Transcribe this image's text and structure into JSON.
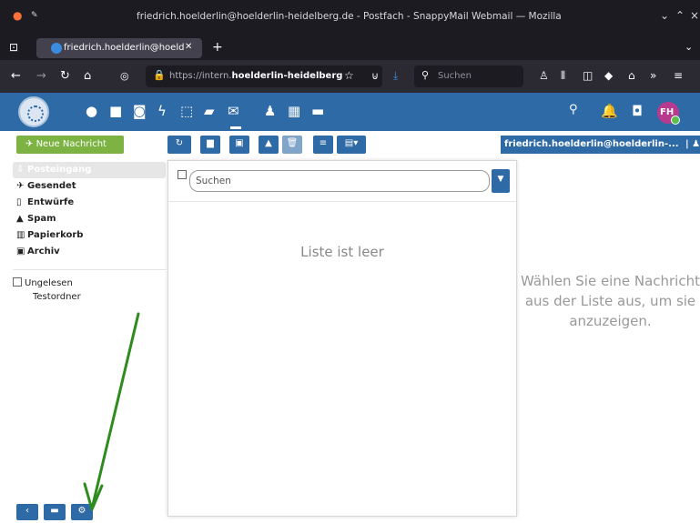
{
  "browser": {
    "window_title": "friedrich.hoelderlin@hoelderlin-heidelberg.de - Postfach - SnappyMail Webmail — Mozilla Firefox",
    "tab_title": "friedrich.hoelderlin@hoeld",
    "url_prefix": "https://intern.",
    "url_domain": "hoelderlin-heidelberg",
    "search_placeholder": "Suchen"
  },
  "app": {
    "avatar_initials": "FH",
    "compose_label": "Neue Nachricht",
    "account_label": "friedrich.hoelderlin@hoelderlin-...",
    "folders": [
      {
        "label": "Posteingang",
        "icon": "inbox-icon",
        "active": true
      },
      {
        "label": "Gesendet",
        "icon": "send-icon"
      },
      {
        "label": "Entwürfe",
        "icon": "draft-icon"
      },
      {
        "label": "Spam",
        "icon": "spam-icon"
      },
      {
        "label": "Papierkorb",
        "icon": "trash-icon"
      },
      {
        "label": "Archiv",
        "icon": "archive-icon"
      }
    ],
    "unread_label": "Ungelesen",
    "testfolder_label": "Testordner",
    "search_placeholder": "Suchen",
    "empty_list_text": "Liste ist leer",
    "preview_text": "Wählen Sie eine Nachricht aus der Liste aus, um sie anzuzeigen."
  },
  "colors": {
    "app_blue": "#2e6aa6",
    "compose_green": "#7cb342",
    "annotation_arrow": "#2e8b1e"
  }
}
